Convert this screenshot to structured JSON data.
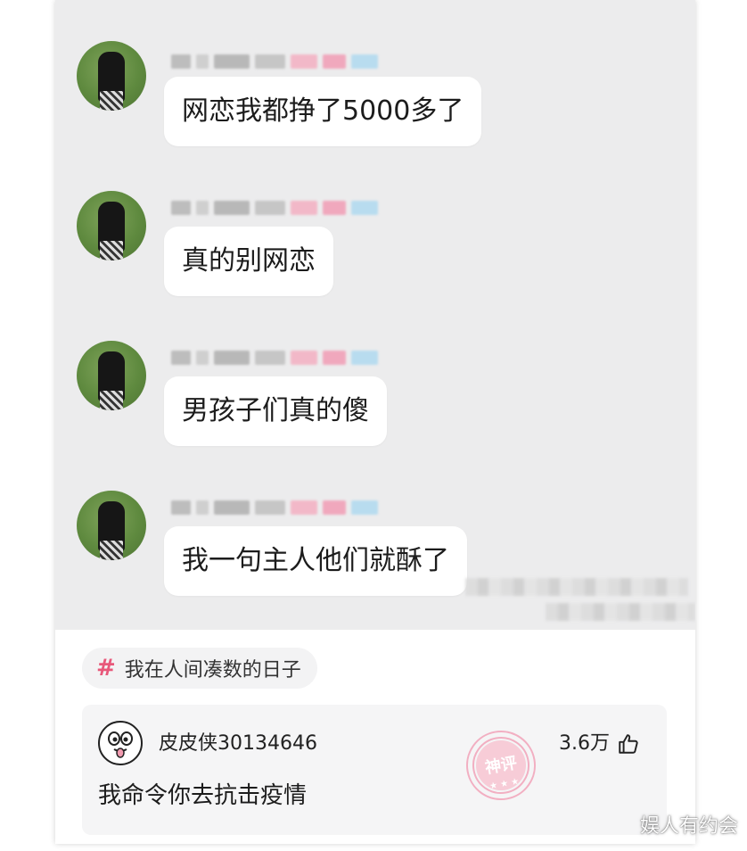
{
  "chat": {
    "messages": [
      {
        "text": "网恋我都挣了5000多了"
      },
      {
        "text": "真的别网恋"
      },
      {
        "text": "男孩子们真的傻"
      },
      {
        "text": "我一句主人他们就酥了"
      }
    ]
  },
  "topic": {
    "hash_symbol": "#",
    "label": "我在人间凑数的日子"
  },
  "comment": {
    "username": "皮皮侠30134646",
    "likes": "3.6万",
    "text": "我命令你去抗击疫情",
    "stamp_label": "神评"
  },
  "watermark": "娱人有约会",
  "colors": {
    "accent": "#e8587a",
    "chat_bg": "#ececed",
    "bubble_bg": "#ffffff",
    "card_bg": "#f5f5f6"
  }
}
